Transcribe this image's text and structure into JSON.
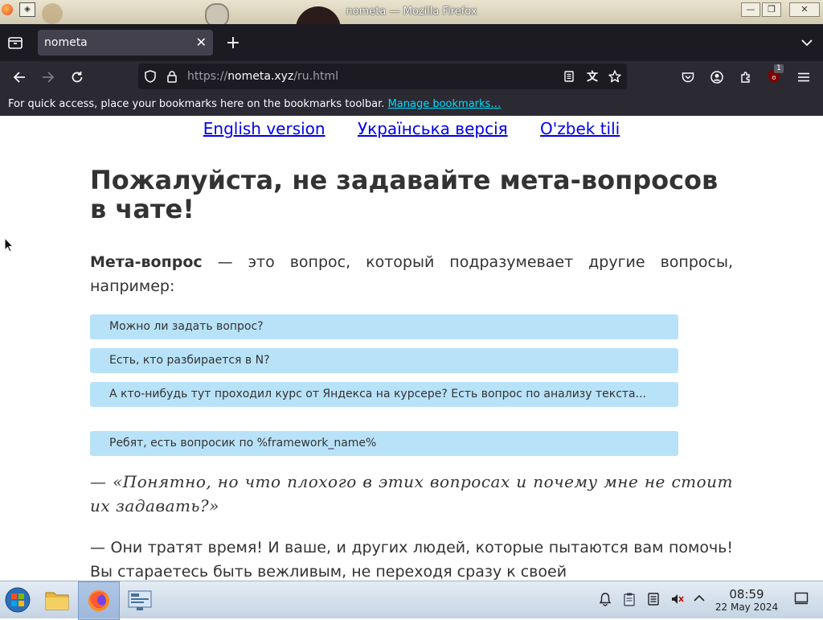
{
  "window": {
    "title": "nometa — Mozilla Firefox",
    "minimize_glyph": "—",
    "maximize_glyph": "❐",
    "close_glyph": "✕"
  },
  "browser": {
    "tab_label": "nometa",
    "tab_close_glyph": "✕",
    "new_tab_glyph": "+",
    "url_prefix": "https://",
    "url_host": "nometa.xyz",
    "url_path": "/ru.html",
    "extension_badge": "1",
    "bookmarks_message": "For quick access, place your bookmarks here on the bookmarks toolbar.",
    "manage_bookmarks": "Manage bookmarks…"
  },
  "page": {
    "languages": [
      "English version",
      "Українська версія",
      "O'zbek tili"
    ],
    "heading": "Пожалуйста, не задавайте мета-вопросов в чате!",
    "intro_bold": "Мета-вопрос",
    "intro_rest": " — это вопрос, который подразумевает другие вопросы, например:",
    "examples": [
      "Можно ли задать вопрос?",
      "Есть, кто разбирается в N?",
      "А кто-нибудь тут проходил курс от Яндекса на курсере? Есть вопрос по анализу текста...",
      "Ребят, есть вопросик по %framework_name%"
    ],
    "quote": "— «Понятно, но что плохого в этих вопросах и почему мне не стоит их задавать?»",
    "answer": "— Они тратят время! И ваше, и других людей, которые пытаются вам помочь! Вы стараетесь быть вежливым, не переходя сразу к своей"
  },
  "taskbar": {
    "time": "08:59",
    "date": "22 May 2024"
  },
  "colors": {
    "example_bg": "#b8e2f8",
    "link": "#0000ee",
    "browser_dark": "#2b2a33",
    "tabbar_dark": "#1c1b22"
  }
}
